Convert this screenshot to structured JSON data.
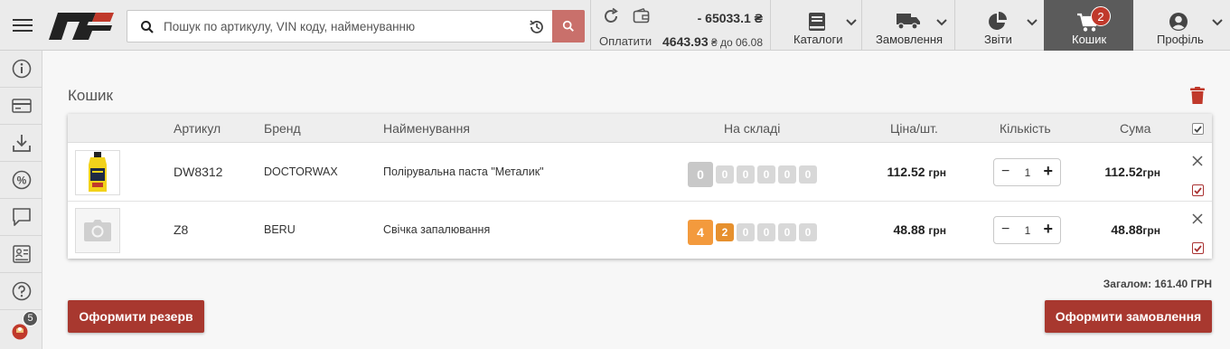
{
  "header": {
    "search_placeholder": "Пошук по артикулу, VIN коду, найменуванню",
    "balance": {
      "debt": "- 65033.1 ₴",
      "pay_label": "Оплатити",
      "due_amount": "4643.93",
      "due_suffix": " ₴ до 06.08"
    },
    "nav": {
      "catalogs": "Каталоги",
      "orders": "Замовлення",
      "reports": "Звіти",
      "cart": "Кошик",
      "cart_count": "2",
      "profile": "Профіль"
    }
  },
  "sidebar": {
    "items": [
      "info-icon",
      "card-icon",
      "download-icon",
      "percent-icon",
      "chat-icon",
      "document-icon",
      "help-icon",
      "notifications-icon"
    ],
    "notifications_count": "5"
  },
  "cart": {
    "title": "Кошик",
    "columns": {
      "sku": "Артикул",
      "brand": "Бренд",
      "name": "Найменування",
      "stock": "На складі",
      "price": "Ціна/шт.",
      "qty": "Кількість",
      "sum": "Сума"
    },
    "currency": "грн",
    "rows": [
      {
        "sku": "DW8312",
        "brand": "DOCTORWAX",
        "name": "Полірувальна паста \"Металик\"",
        "stock": [
          "0",
          "0",
          "0",
          "0",
          "0",
          "0"
        ],
        "price": "112.52",
        "qty": "1",
        "sum": "112.52"
      },
      {
        "sku": "Z8",
        "brand": "BERU",
        "name": "Свічка запалювання",
        "stock": [
          "4",
          "2",
          "0",
          "0",
          "0",
          "0"
        ],
        "price": "48.88",
        "qty": "1",
        "sum": "48.88"
      }
    ],
    "total": "Загалом: 161.40 ГРН",
    "reserve_button": "Оформити резерв",
    "order_button": "Оформити замовлення"
  },
  "colors": {
    "accent": "#a8382f",
    "search_button": "#c9706b",
    "active_nav": "#5b5b5b",
    "stock_orange": "#f39a3d",
    "stock_grey": "#c8c8c8"
  }
}
